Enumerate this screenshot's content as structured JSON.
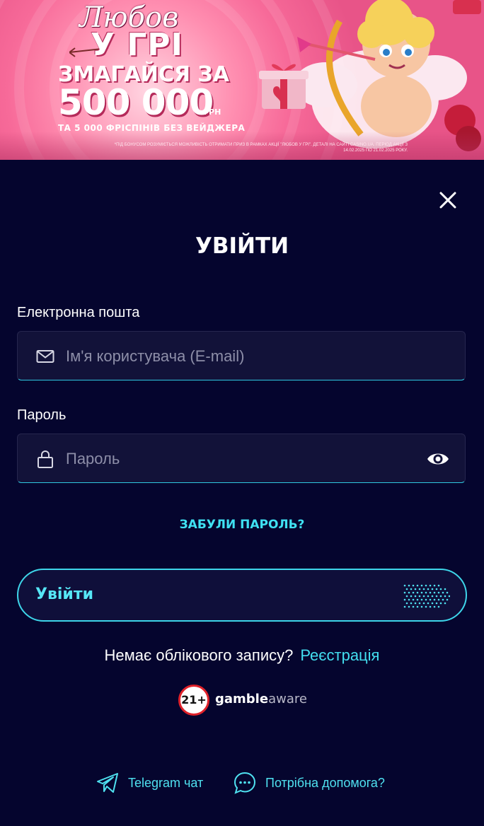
{
  "banner": {
    "script_title": "Любов",
    "title": "У ГРІ",
    "headline": "ЗМАГАЙСЯ ЗА",
    "amount": "500 000",
    "currency": "ГРН",
    "subline": "ТА 5 000 ФРІСПІНІВ БЕЗ ВЕЙДЖЕРА",
    "disclaimer": "*ПІД БОНУСОМ РОЗУМІЄТЬСЯ МОЖЛИВІСТЬ ОТРИМАТИ ПРИЗ В РАМКАХ АКЦІЇ \"ЛЮБОВ У ГРІ\". ДЕТАЛІ НА САЙТІ CASINO.UA. ПЕРІОД АКЦІЇ З 14.02.2025 ПО 21.02.2025 РОКУ."
  },
  "modal": {
    "title": "УВІЙТИ",
    "close_icon": "close-icon"
  },
  "form": {
    "email": {
      "label": "Електронна пошта",
      "placeholder": "Ім'я користувача (E-mail)",
      "value": "",
      "icon": "envelope-icon"
    },
    "password": {
      "label": "Пароль",
      "placeholder": "Пароль",
      "value": "",
      "icon": "lock-icon",
      "toggle_icon": "eye-icon"
    },
    "forgot_label": "ЗАБУЛИ ПАРОЛЬ?",
    "submit_label": "Увійти"
  },
  "signup": {
    "question": "Немає облікового запису?",
    "link": "Реєстрація"
  },
  "gambleaware": {
    "badge": "21+",
    "brand_bold": "gamble",
    "brand_light": "aware"
  },
  "footer": {
    "telegram_label": "Telegram чат",
    "help_label": "Потрібна допомога?"
  },
  "colors": {
    "background": "#05052e",
    "accent": "#3ed6ea",
    "input_bg": "#121239",
    "banner_pink": "#f76a99"
  }
}
